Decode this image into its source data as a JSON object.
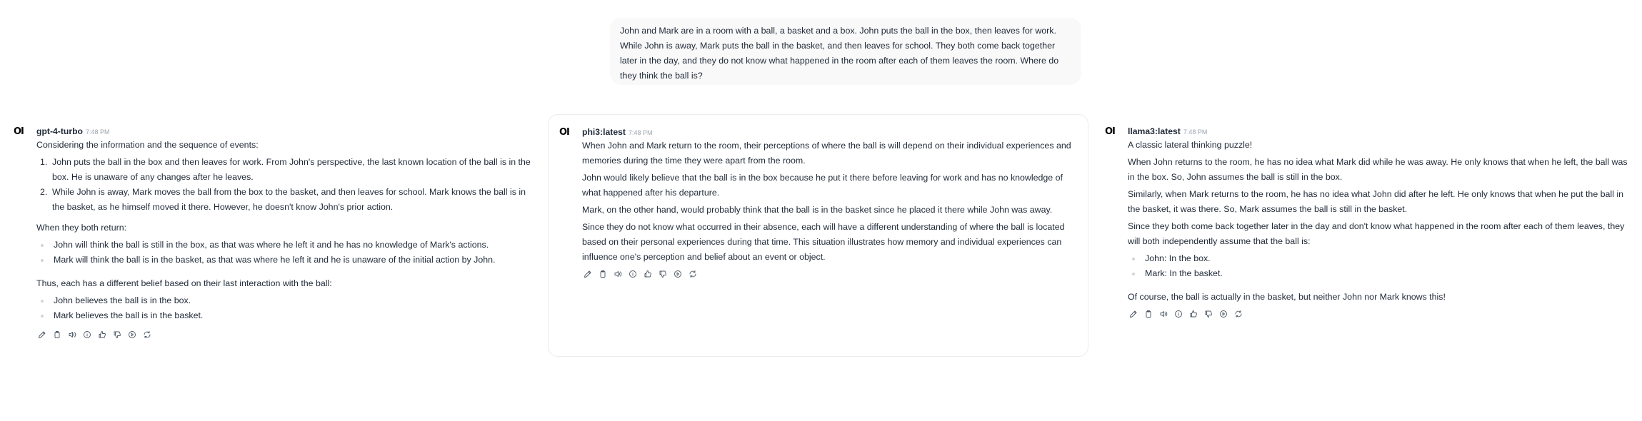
{
  "user_message": "John and Mark are in a room with a ball, a basket and a box. John puts the ball in the box, then leaves for work. While John is away, Mark puts the ball in the basket, and then leaves for school. They both come back together later in the day, and they do not know what happened in the room after each of them leaves the room. Where do they think the ball is?",
  "avatar_text": "OI",
  "responses": [
    {
      "model": "gpt-4-turbo",
      "time": "7:48 PM",
      "intro": "Considering the information and the sequence of events:",
      "steps": [
        {
          "num": "1.",
          "text": "John puts the ball in the box and then leaves for work. From John's perspective, the last known location of the ball is in the box. He is unaware of any changes after he leaves."
        },
        {
          "num": "2.",
          "text": "While John is away, Mark moves the ball from the box to the basket, and then leaves for school. Mark knows the ball is in the basket, as he himself moved it there. However, he doesn't know John's prior action."
        }
      ],
      "return_heading": "When they both return:",
      "return_bullets": [
        "John will think the ball is still in the box, as that was where he left it and he has no knowledge of Mark's actions.",
        "Mark will think the ball is in the basket, as that was where he left it and he is unaware of the initial action by John."
      ],
      "summary_heading": "Thus, each has a different belief based on their last interaction with the ball:",
      "summary_bullets": [
        "John believes the ball is in the box.",
        "Mark believes the ball is in the basket."
      ]
    },
    {
      "model": "phi3:latest",
      "time": "7:48 PM",
      "paragraphs": [
        "When John and Mark return to the room, their perceptions of where the ball is will depend on their individual experiences and memories during the time they were apart from the room.",
        "John would likely believe that the ball is in the box because he put it there before leaving for work and has no knowledge of what happened after his departure.",
        "Mark, on the other hand, would probably think that the ball is in the basket since he placed it there while John was away.",
        "Since they do not know what occurred in their absence, each will have a different understanding of where the ball is located based on their personal experiences during that time. This situation illustrates how memory and individual experiences can influence one's perception and belief about an event or object."
      ]
    },
    {
      "model": "llama3:latest",
      "time": "7:48 PM",
      "paragraphs": [
        "A classic lateral thinking puzzle!",
        "When John returns to the room, he has no idea what Mark did while he was away. He only knows that when he left, the ball was in the box. So, John assumes the ball is still in the box.",
        "Similarly, when Mark returns to the room, he has no idea what John did after he left. He only knows that when he put the ball in the basket, it was there. So, Mark assumes the ball is still in the basket.",
        "Since they both come back together later in the day and don't know what happened in the room after each of them leaves, they will both independently assume that the ball is:"
      ],
      "bullets": [
        "John: In the box.",
        "Mark: In the basket."
      ],
      "closing": "Of course, the ball is actually in the basket, but neither John nor Mark knows this!"
    }
  ],
  "action_icons": [
    "edit-icon",
    "copy-icon",
    "speaker-icon",
    "info-icon",
    "thumbs-up-icon",
    "thumbs-down-icon",
    "continue-icon",
    "regenerate-icon"
  ]
}
